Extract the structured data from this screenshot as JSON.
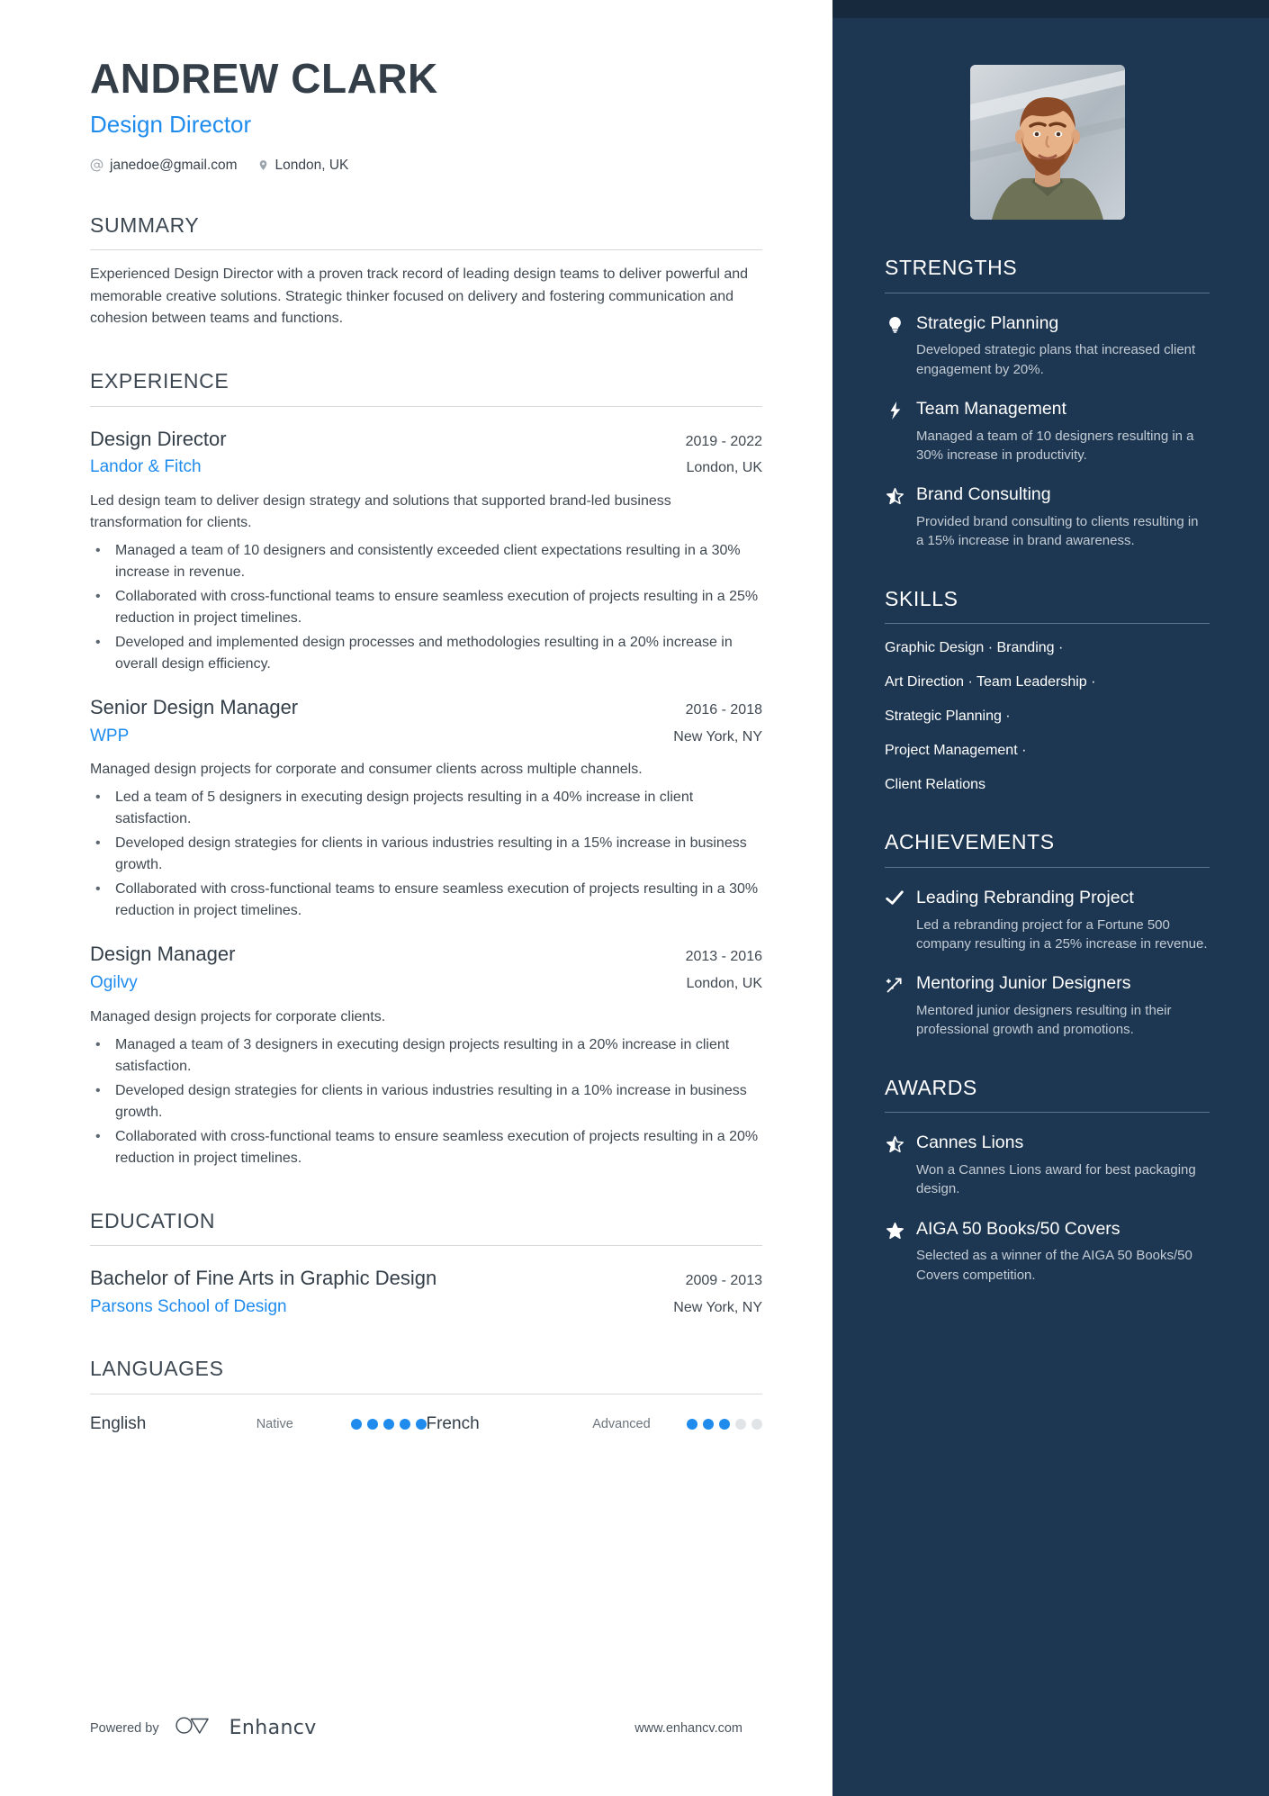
{
  "header": {
    "name": "ANDREW CLARK",
    "title": "Design Director",
    "email": "janedoe@gmail.com",
    "location": "London, UK",
    "email_icon": "at-sign-icon",
    "location_icon": "map-pin-icon"
  },
  "colors": {
    "accent_blue": "#1f8ced",
    "sidebar_bg": "#1d3651",
    "sidebar_top_bg": "#16293d",
    "heading_dark": "#3d4852",
    "body_text": "#3f4851"
  },
  "summary": {
    "heading": "SUMMARY",
    "text": "Experienced Design Director with a proven track record of leading design teams to deliver powerful and memorable creative solutions. Strategic thinker focused on delivery and fostering communication and cohesion between teams and functions."
  },
  "experience": {
    "heading": "EXPERIENCE",
    "entries": [
      {
        "role": "Design Director",
        "organization": "Landor & Fitch",
        "dates": "2019 - 2022",
        "location": "London, UK",
        "description": "Led design team to deliver design strategy and solutions that supported brand-led business transformation for clients.",
        "bullets": [
          "Managed a team of 10 designers and consistently exceeded client expectations resulting in a 30% increase in revenue.",
          "Collaborated with cross-functional teams to ensure seamless execution of projects resulting in a 25% reduction in project timelines.",
          "Developed and implemented design processes and methodologies resulting in a 20% increase in overall design efficiency."
        ]
      },
      {
        "role": "Senior Design Manager",
        "organization": "WPP",
        "dates": "2016 - 2018",
        "location": "New York, NY",
        "description": "Managed design projects for corporate and consumer clients across multiple channels.",
        "bullets": [
          "Led a team of 5 designers in executing design projects resulting in a 40% increase in client satisfaction.",
          "Developed design strategies for clients in various industries resulting in a 15% increase in business growth.",
          "Collaborated with cross-functional teams to ensure seamless execution of projects resulting in a 30% reduction in project timelines."
        ]
      },
      {
        "role": "Design Manager",
        "organization": "Ogilvy",
        "dates": "2013 - 2016",
        "location": "London, UK",
        "description": "Managed design projects for corporate clients.",
        "bullets": [
          "Managed a team of 3 designers in executing design projects resulting in a 20% increase in client satisfaction.",
          "Developed design strategies for clients in various industries resulting in a 10% increase in business growth.",
          "Collaborated with cross-functional teams to ensure seamless execution of projects resulting in a 20% reduction in project timelines."
        ]
      }
    ]
  },
  "education": {
    "heading": "EDUCATION",
    "entries": [
      {
        "degree": "Bachelor of Fine Arts in Graphic Design",
        "school": "Parsons School of Design",
        "dates": "2009 - 2013",
        "location": "New York, NY"
      }
    ]
  },
  "languages": {
    "heading": "LANGUAGES",
    "items": [
      {
        "name": "English",
        "level": "Native",
        "filled": 5,
        "total": 5
      },
      {
        "name": "French",
        "level": "Advanced",
        "filled": 3,
        "total": 5
      }
    ]
  },
  "footer": {
    "powered_by": "Powered by",
    "brand": "Enhancv",
    "brand_logo_icon": "enhancv-infinity-logo-icon",
    "url": "www.enhancv.com"
  },
  "sidebar": {
    "photo_alt": "profile-photo",
    "strengths": {
      "heading": "STRENGTHS",
      "items": [
        {
          "icon": "lightbulb-icon",
          "title": "Strategic Planning",
          "desc": "Developed strategic plans that increased client engagement by 20%."
        },
        {
          "icon": "lightning-bolt-icon",
          "title": "Team Management",
          "desc": "Managed a team of 10 designers resulting in a 30% increase in productivity."
        },
        {
          "icon": "half-star-icon",
          "title": "Brand Consulting",
          "desc": "Provided brand consulting to clients resulting in a 15% increase in brand awareness."
        }
      ]
    },
    "skills": {
      "heading": "SKILLS",
      "lines": [
        "Graphic Design · Branding ·",
        "Art Direction · Team Leadership ·",
        "Strategic Planning ·",
        "Project Management ·",
        "Client Relations"
      ]
    },
    "achievements": {
      "heading": "ACHIEVEMENTS",
      "items": [
        {
          "icon": "checkmark-icon",
          "title": "Leading Rebranding Project",
          "desc": "Led a rebranding project for a Fortune 500 company resulting in a 25% increase in revenue."
        },
        {
          "icon": "rocket-sparkle-icon",
          "title": "Mentoring Junior Designers",
          "desc": "Mentored junior designers resulting in their professional growth and promotions."
        }
      ]
    },
    "awards": {
      "heading": "AWARDS",
      "items": [
        {
          "icon": "half-star-icon",
          "title": "Cannes Lions",
          "desc": "Won a Cannes Lions award for best packaging design."
        },
        {
          "icon": "star-icon",
          "title": "AIGA 50 Books/50 Covers",
          "desc": "Selected as a winner of the AIGA 50 Books/50 Covers competition."
        }
      ]
    }
  }
}
